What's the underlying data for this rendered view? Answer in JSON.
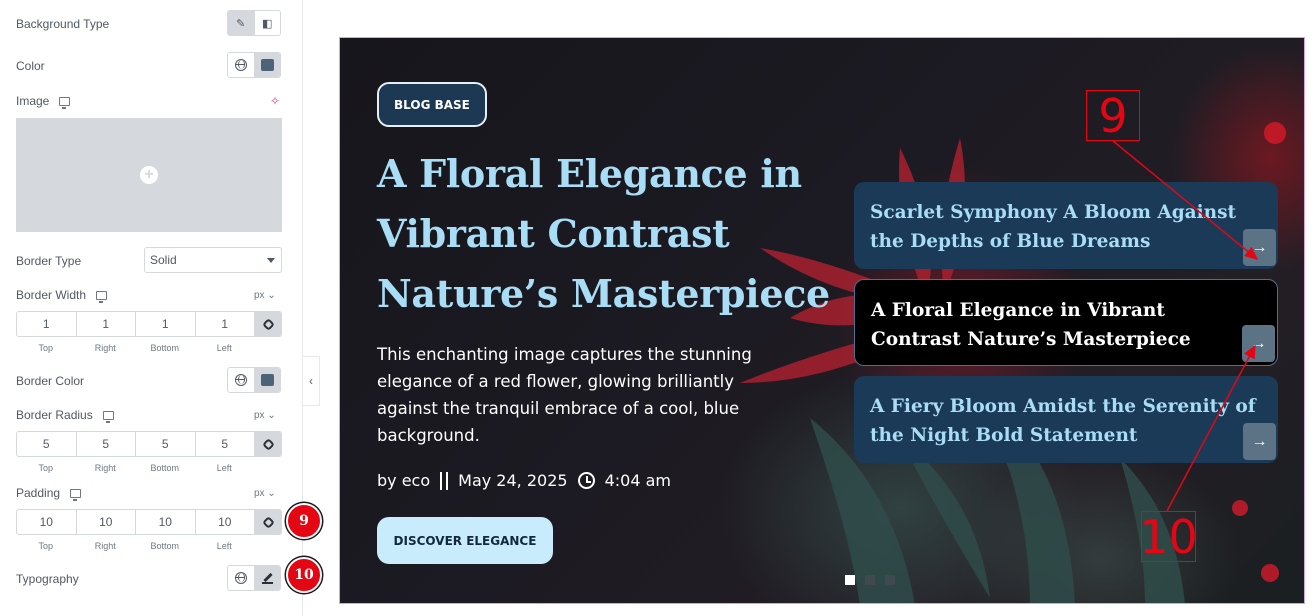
{
  "panel": {
    "background_type": {
      "label": "Background Type",
      "options": [
        "brush-icon",
        "gradient-icon"
      ],
      "selected": 0
    },
    "color": {
      "label": "Color",
      "value": "#4d6378"
    },
    "image": {
      "label": "Image"
    },
    "border_type": {
      "label": "Border Type",
      "value": "Solid"
    },
    "border_width": {
      "label": "Border Width",
      "unit": "px",
      "values": [
        "1",
        "1",
        "1",
        "1"
      ]
    },
    "border_color": {
      "label": "Border Color"
    },
    "border_radius": {
      "label": "Border Radius",
      "unit": "px",
      "values": [
        "5",
        "5",
        "5",
        "5"
      ]
    },
    "padding": {
      "label": "Padding",
      "unit": "px",
      "values": [
        "10",
        "10",
        "10",
        "10"
      ]
    },
    "dim_labels": [
      "Top",
      "Right",
      "Bottom",
      "Left"
    ],
    "typography": {
      "label": "Typography"
    },
    "badges": [
      "9",
      "10"
    ]
  },
  "hero": {
    "category": "BLOG BASE",
    "title": "A Floral Elegance in Vibrant Contrast Nature’s Masterpiece",
    "description": "This enchanting image captures the stunning elegance of a red flower, glowing brilliantly against the tranquil embrace of a cool, blue background.",
    "author": "by eco",
    "date": "May 24, 2025",
    "time": "4:04 am",
    "cta": "DISCOVER ELEGANCE",
    "cards": [
      {
        "title": "Scarlet Symphony A Bloom Against the Depths of Blue Dreams",
        "active": false
      },
      {
        "title": "A Floral Elegance in Vibrant Contrast Nature’s Masterpiece",
        "active": true
      },
      {
        "title": "A Fiery Bloom Amidst the Serenity of the Night Bold Statement",
        "active": false
      }
    ],
    "slides": 3,
    "current_slide": 1
  },
  "annotations": [
    "9",
    "10"
  ],
  "colors": {
    "accent_red": "#e40613",
    "title_blue": "#a9dcf5",
    "card_bg": "#1b3a58",
    "cta_bg": "#c8ecfc"
  }
}
